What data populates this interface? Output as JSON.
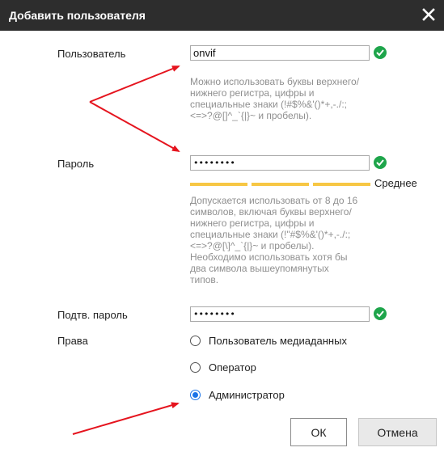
{
  "dialog": {
    "title": "Добавить пользователя"
  },
  "form": {
    "username": {
      "label": "Пользователь",
      "value": "onvif",
      "hint": "Можно использовать буквы верхнего/нижнего регистра, цифры и специальные знаки (!#$%&'()*+,-./:;<=>?@[]^_`{|}~ и пробелы)."
    },
    "password": {
      "label": "Пароль",
      "value": "••••••••",
      "strength_label": "Среднее",
      "strength_segments": [
        "filled",
        "filled",
        "filled",
        "empty"
      ],
      "hint": "Допускается использовать от 8 до 16 символов, включая буквы верхнего/нижнего регистра, цифры и специальные знаки (!\"#$%&'()*+,-./:;<=>?@[\\]^_`{|}~ и пробелы). Необходимо использовать хотя бы два символа вышеупомянутых типов."
    },
    "confirm": {
      "label": "Подтв. пароль",
      "value": "••••••••"
    },
    "rights": {
      "label": "Права",
      "options": [
        {
          "label": "Пользователь медиаданных",
          "checked": false
        },
        {
          "label": "Оператор",
          "checked": false
        },
        {
          "label": "Администратор",
          "checked": true
        }
      ]
    }
  },
  "buttons": {
    "ok": "ОК",
    "cancel": "Отмена"
  },
  "colors": {
    "titlebar": "#2d2d2d",
    "check_green": "#1ea54b",
    "strength_filled": "#f7c744",
    "strength_empty": "#cccccc",
    "radio_accent": "#1a73e8",
    "arrow_red": "#e5141e"
  }
}
